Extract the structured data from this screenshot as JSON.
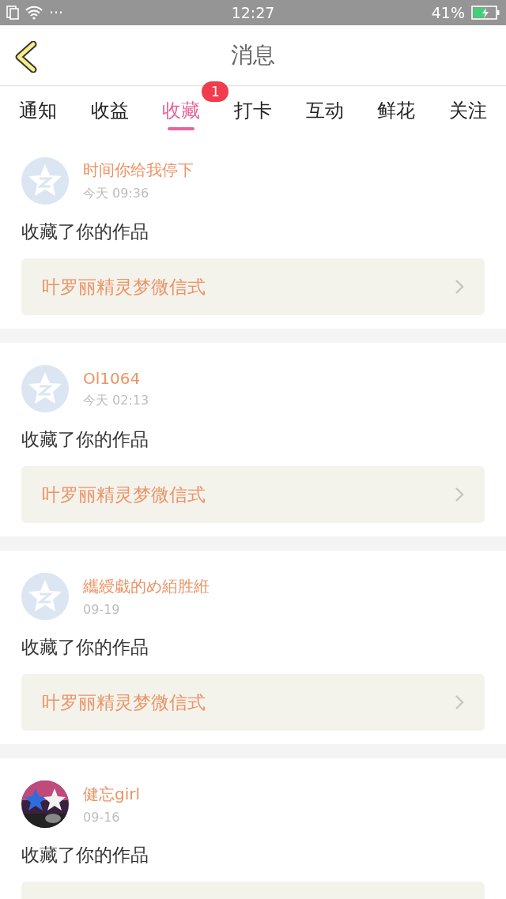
{
  "status_bar": {
    "time": "12:27",
    "dots": "···",
    "battery": "41%"
  },
  "header": {
    "title": "消息"
  },
  "tabs": [
    {
      "label": "通知",
      "selected": false
    },
    {
      "label": "收益",
      "selected": false
    },
    {
      "label": "收藏",
      "selected": true,
      "badge": "1"
    },
    {
      "label": "打卡",
      "selected": false
    },
    {
      "label": "互动",
      "selected": false
    },
    {
      "label": "鲜花",
      "selected": false
    },
    {
      "label": "关注",
      "selected": false
    }
  ],
  "messages": [
    {
      "avatar": {
        "kind": "default"
      },
      "name": "时间你给我停下",
      "time": "今天 09:36",
      "action": "收藏了你的作品",
      "work": "叶罗丽精灵梦微信式"
    },
    {
      "avatar": {
        "kind": "default"
      },
      "name": "Ol1064",
      "time": "今天 02:13",
      "action": "收藏了你的作品",
      "work": "叶罗丽精灵梦微信式"
    },
    {
      "avatar": {
        "kind": "default"
      },
      "name": "纗綬戱的め絔胜絍",
      "time": "09-19",
      "action": "收藏了你的作品",
      "work": "叶罗丽精灵梦微信式"
    },
    {
      "name": "健忘girl",
      "time": "09-16",
      "action": "收藏了你的作品"
    }
  ]
}
